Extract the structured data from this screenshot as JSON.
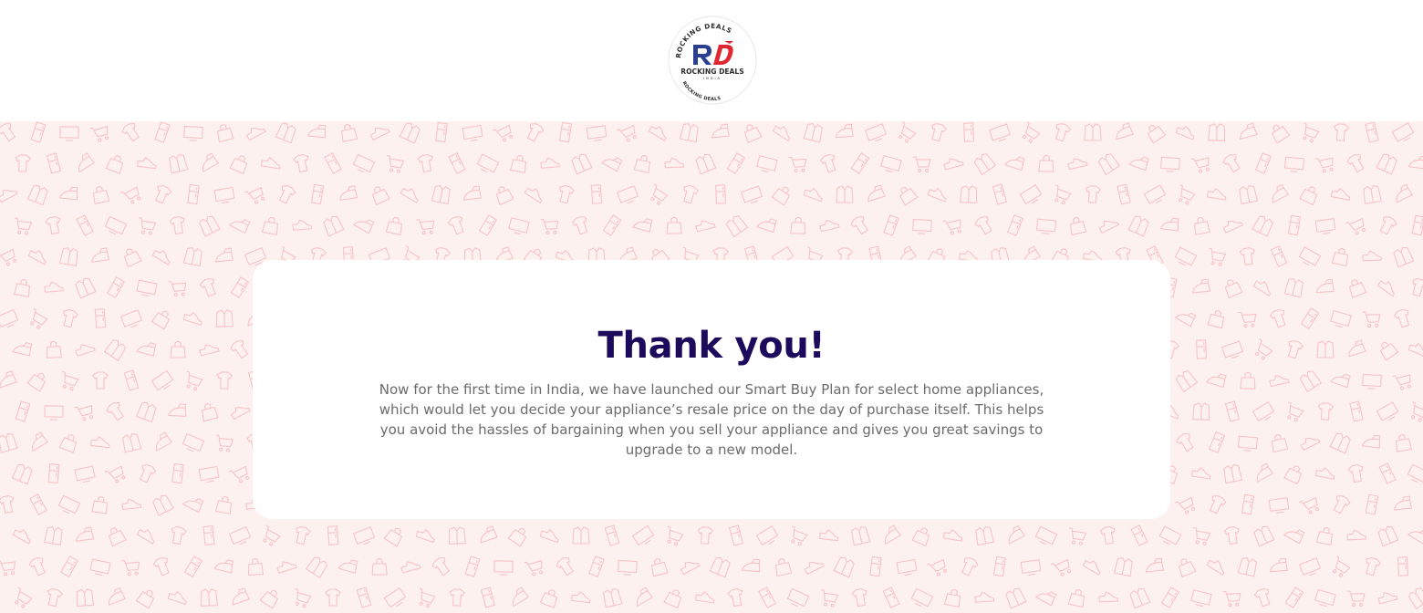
{
  "brand": {
    "logo_name": "ROCKING DEALS",
    "logo_sub": "INDIA",
    "logo_ring_text": "ROCKING DEALS",
    "logo_colors": {
      "blue": "#2a3f8f",
      "red": "#e0262e",
      "text": "#2b2b2b"
    }
  },
  "background": {
    "color": "#fdf1f0",
    "pattern_color": "#f6b3b8",
    "pattern_icons": [
      "shirt-icon",
      "shoe-icon",
      "shopping-cart-icon",
      "shopping-bag-icon",
      "tv-icon",
      "iron-icon",
      "refrigerator-icon",
      "jacket-icon"
    ]
  },
  "card": {
    "title": "Thank you!",
    "message": "Now for the first time in India, we have launched our Smart Buy Plan for select home appliances, which would let you decide your appliance’s resale price on the day of purchase itself. This helps you avoid the hassles of bargaining when you sell your appliance and gives you great savings to upgrade to a new model.",
    "title_color": "#1c0b5c",
    "text_color": "#6b6b6b"
  }
}
